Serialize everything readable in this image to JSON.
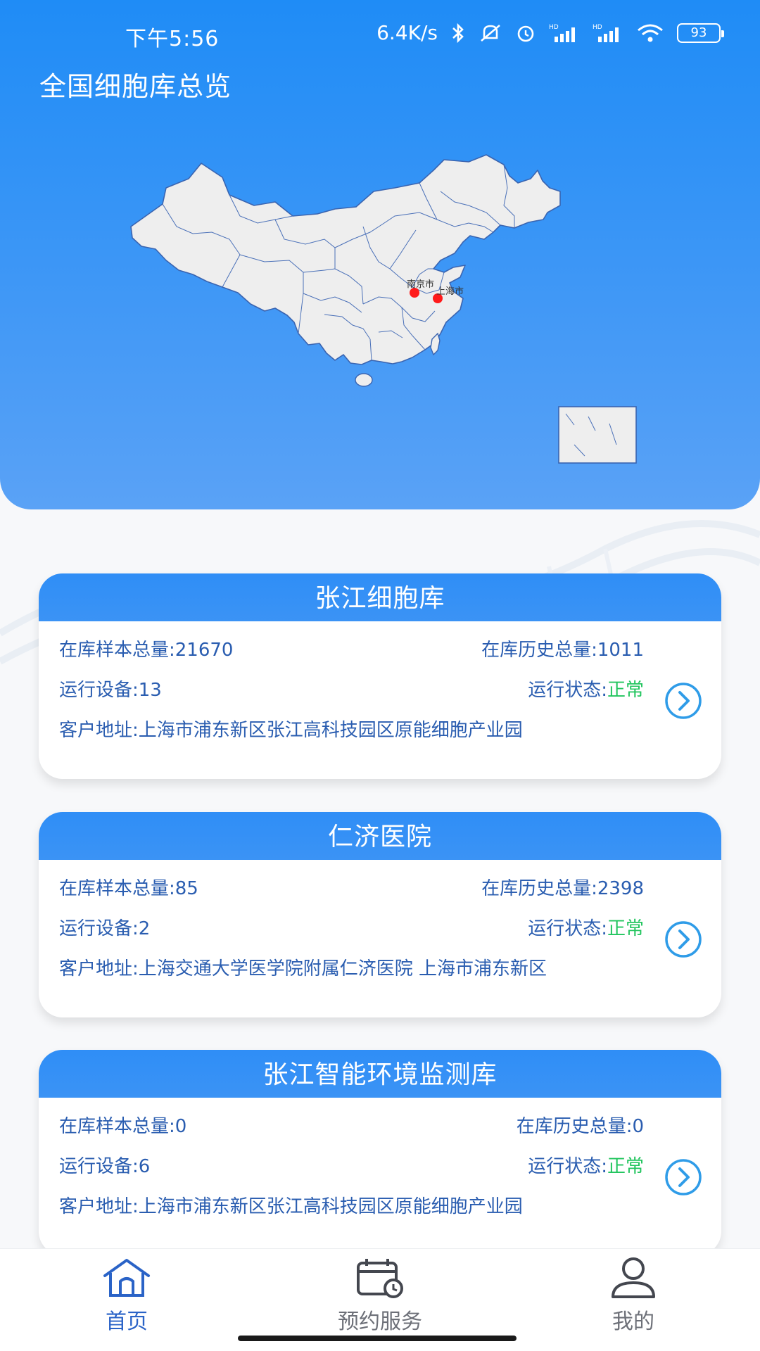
{
  "status_bar": {
    "time": "下午5:56",
    "net_speed": "6.4K/s",
    "battery": "93",
    "icons": [
      "bluetooth-icon",
      "mute-icon",
      "alarm-icon",
      "signal-hd-icon",
      "signal-hd-icon",
      "wifi-icon",
      "battery-icon"
    ]
  },
  "header": {
    "title": "全国细胞库总览"
  },
  "map": {
    "markers": [
      {
        "label": "南京市",
        "color": "#ff1a1a"
      },
      {
        "label": "上海市",
        "color": "#ff1a1a"
      }
    ]
  },
  "cards": [
    {
      "title": "张江细胞库",
      "samples_label": "在库样本总量:21670",
      "history_label": "在库历史总量:1011",
      "devices_label": "运行设备:13",
      "status_prefix": "运行状态:",
      "status_value": "正常",
      "address_label": "客户地址:上海市浦东新区张江高科技园区原能细胞产业园"
    },
    {
      "title": "仁济医院",
      "samples_label": "在库样本总量:85",
      "history_label": "在库历史总量:2398",
      "devices_label": "运行设备:2",
      "status_prefix": "运行状态:",
      "status_value": "正常",
      "address_label": "客户地址:上海交通大学医学院附属仁济医院 上海市浦东新区"
    },
    {
      "title": "张江智能环境监测库",
      "samples_label": "在库样本总量:0",
      "history_label": "在库历史总量:0",
      "devices_label": "运行设备:6",
      "status_prefix": "运行状态:",
      "status_value": "正常",
      "address_label": "客户地址:上海市浦东新区张江高科技园区原能细胞产业园"
    }
  ],
  "tabbar": {
    "items": [
      {
        "label": "首页",
        "icon": "home-icon",
        "active": true
      },
      {
        "label": "预约服务",
        "icon": "calendar-clock-icon",
        "active": false
      },
      {
        "label": "我的",
        "icon": "user-icon",
        "active": false
      }
    ]
  },
  "colors": {
    "header_top": "#1f8cf6",
    "card_header": "#2f8ef6",
    "text_blue": "#2a5db0",
    "status_ok": "#22c55e",
    "marker": "#ff1a1a",
    "tab_active": "#2a63c7",
    "tab_inactive": "#6d7078"
  }
}
